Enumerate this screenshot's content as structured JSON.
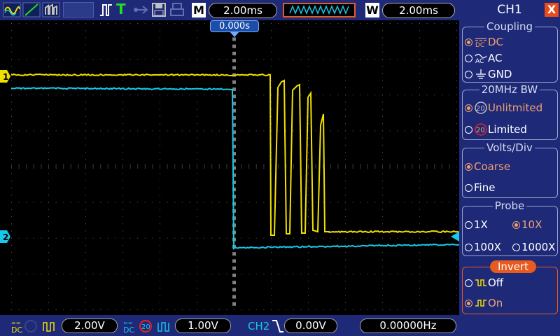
{
  "toolbar": {
    "run_indicator": "T",
    "timebase_letter": "M",
    "timebase_value": "2.00ms",
    "window_letter": "W",
    "window_value": "2.00ms"
  },
  "trigger_position": "0.000s",
  "channel_markers": {
    "ch1": "1",
    "ch2": "2"
  },
  "colors": {
    "ch1": "#f0e000",
    "ch2": "#18c8e8",
    "accent": "#e85a1e",
    "panel_bg": "#1e2a78"
  },
  "bottom": {
    "ch1_volts": "2.00V",
    "ch2_volts": "1.00V",
    "trigger_source": "CH2",
    "trigger_level": "0.00V",
    "frequency": "0.00000Hz"
  },
  "panel": {
    "title": "CH1",
    "close_label": "X",
    "coupling": {
      "title": "Coupling",
      "options": [
        {
          "label": "DC",
          "selected": true
        },
        {
          "label": "AC",
          "selected": false
        },
        {
          "label": "GND",
          "selected": false
        }
      ]
    },
    "bandwidth": {
      "title": "20MHz BW",
      "options": [
        {
          "label": "Unlitmited",
          "selected": true
        },
        {
          "label": "Limited",
          "selected": false
        }
      ]
    },
    "volts_div": {
      "title": "Volts/Div",
      "options": [
        {
          "label": "Coarse",
          "selected": true
        },
        {
          "label": "Fine",
          "selected": false
        }
      ]
    },
    "probe": {
      "title": "Probe",
      "options": [
        {
          "label": "1X",
          "selected": false
        },
        {
          "label": "10X",
          "selected": true
        },
        {
          "label": "100X",
          "selected": false
        },
        {
          "label": "1000X",
          "selected": false
        }
      ]
    },
    "invert": {
      "title": "Invert",
      "options": [
        {
          "label": "Off",
          "selected": false
        },
        {
          "label": "On",
          "selected": true
        }
      ]
    }
  }
}
